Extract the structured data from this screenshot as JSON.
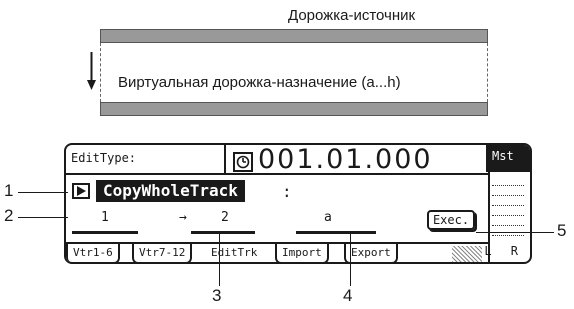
{
  "diagram": {
    "source_label": "Дорожка-источник",
    "destination_label": "Виртуальная дорожка-назначение (a...h)"
  },
  "lcd": {
    "edit_type_label": "EditType:",
    "location": "001.01.000",
    "master_label": "Mst",
    "meter_label": "L R",
    "edit_type_value": "CopyWholeTrack",
    "colon": ":",
    "source_track": "1",
    "arrow": "→",
    "dest_track": "2",
    "virtual_track": "a",
    "exec_label": "Exec.",
    "tabs": [
      "Vtr1-6",
      "Vtr7-12",
      "EditTrk",
      "Import",
      "Export"
    ],
    "active_tab": "EditTrk"
  },
  "callouts": [
    "1",
    "2",
    "3",
    "4",
    "5"
  ]
}
